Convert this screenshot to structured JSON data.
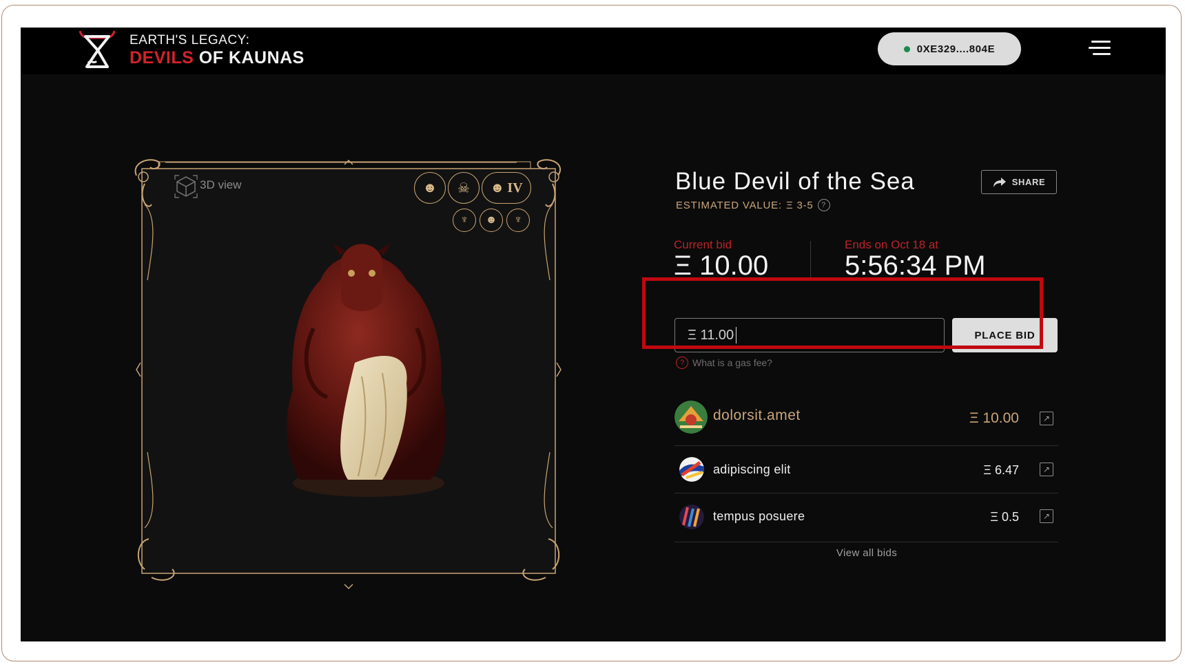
{
  "header": {
    "logo_line1": "EARTH'S LEGACY:",
    "logo_line2_red": "DEVILS",
    "logo_line2_white": "OF KAUNAS",
    "wallet_address": "0XE329....804E"
  },
  "viewer": {
    "view_label": "3D view",
    "badge_roman": "IV",
    "icons": [
      "cube-icon",
      "theater-mask-icon",
      "skull-crossbones-icon",
      "theater-mask-icon",
      "tree-icon",
      "theater-mask-icon",
      "tree-icon"
    ]
  },
  "item": {
    "title": "Blue Devil of the Sea",
    "share_label": "SHARE",
    "estimated_label": "ESTIMATED VALUE:",
    "estimated_value": "Ξ 3-5"
  },
  "auction": {
    "current_bid_label": "Current bid",
    "current_bid_value": "Ξ 10.00",
    "ends_label": "Ends on Oct 18 at",
    "ends_value": "5:56:34 PM",
    "bid_input_value": "Ξ 11.00",
    "place_bid_label": "PLACE BID",
    "gas_fee_label": "What is a gas fee?"
  },
  "bids": [
    {
      "name": "dolorsit.amet",
      "amount": "Ξ 10.00"
    },
    {
      "name": "adipiscing elit",
      "amount": "Ξ 6.47"
    },
    {
      "name": "tempus posuere",
      "amount": "Ξ 0.5"
    }
  ],
  "view_all_label": "View all bids",
  "colors": {
    "accent_red": "#d2232a",
    "gold": "#c9a574",
    "highlight_red": "#c1080f",
    "background": "#0b0b0b"
  }
}
